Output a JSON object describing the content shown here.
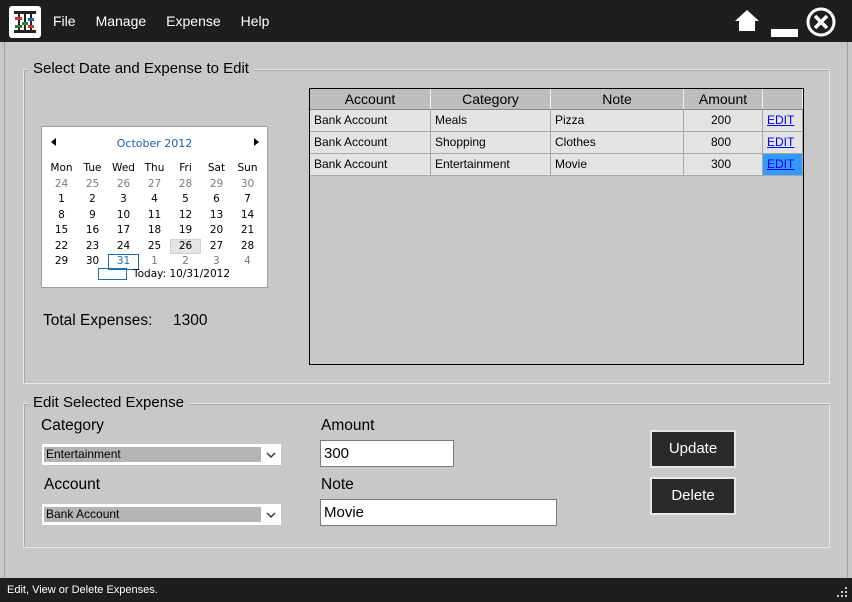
{
  "menu": [
    "File",
    "Manage",
    "Expense",
    "Help"
  ],
  "window_buttons": {
    "home": "home-icon",
    "minimize": "minimize-icon",
    "close": "close-icon"
  },
  "select_group": {
    "title": "Select Date and Expense to Edit",
    "total_label": "Total Expenses:",
    "total_value": "1300"
  },
  "calendar": {
    "month_label": "October 2012",
    "weekdays": [
      "Mon",
      "Tue",
      "Wed",
      "Thu",
      "Fri",
      "Sat",
      "Sun"
    ],
    "weeks": [
      [
        "24",
        "25",
        "26",
        "27",
        "28",
        "29",
        "30"
      ],
      [
        "1",
        "2",
        "3",
        "4",
        "5",
        "6",
        "7"
      ],
      [
        "8",
        "9",
        "10",
        "11",
        "12",
        "13",
        "14"
      ],
      [
        "15",
        "16",
        "17",
        "18",
        "19",
        "20",
        "21"
      ],
      [
        "22",
        "23",
        "24",
        "25",
        "26",
        "27",
        "28"
      ],
      [
        "29",
        "30",
        "31",
        "1",
        "2",
        "3",
        "4"
      ]
    ],
    "today_text": "Today: 10/31/2012",
    "selected_date": "10/26/2012",
    "today_date": "10/31/2012"
  },
  "expense_table": {
    "columns": [
      "Account",
      "Category",
      "Note",
      "Amount",
      ""
    ],
    "rows": [
      {
        "account": "Bank Account",
        "category": "Meals",
        "note": "Pizza",
        "amount": "200",
        "action": "EDIT"
      },
      {
        "account": "Bank Account",
        "category": "Shopping",
        "note": "Clothes",
        "amount": "800",
        "action": "EDIT"
      },
      {
        "account": "Bank Account",
        "category": "Entertainment",
        "note": "Movie",
        "amount": "300",
        "action": "EDIT"
      }
    ],
    "active_row": 3
  },
  "edit_group": {
    "title": "Edit Selected Expense",
    "category_label": "Category",
    "category_value": "Entertainment",
    "account_label": "Account",
    "account_value": "Bank Account",
    "amount_label": "Amount",
    "amount_value": "300",
    "note_label": "Note",
    "note_value": "Movie",
    "update_label": "Update",
    "delete_label": "Delete"
  },
  "status": {
    "text": "Edit, View or Delete Expenses."
  },
  "colors": {
    "titlebar": "#1e1e1e",
    "background": "#c8c8c8",
    "link": "#0000ee",
    "selection": "#3399ff",
    "calendar_month": "#1a5fb4"
  }
}
